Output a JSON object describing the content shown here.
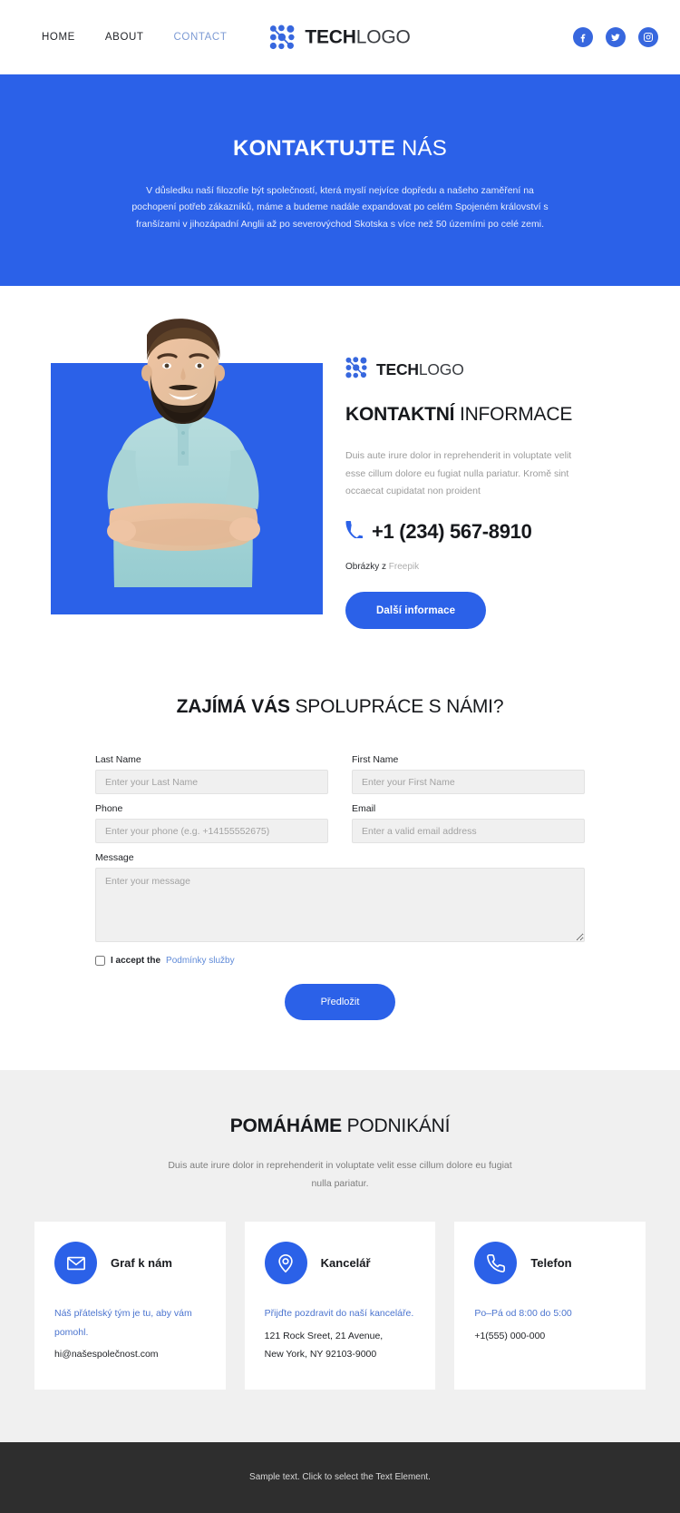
{
  "header": {
    "nav": [
      {
        "label": "HOME",
        "active": false
      },
      {
        "label": "ABOUT",
        "active": false
      },
      {
        "label": "CONTACT",
        "active": true
      }
    ],
    "brand": {
      "bold": "TECH",
      "light": "LOGO"
    },
    "socials": [
      {
        "name": "facebook",
        "label": "Facebook"
      },
      {
        "name": "twitter",
        "label": "Twitter"
      },
      {
        "name": "instagram",
        "label": "Instagram"
      }
    ]
  },
  "hero": {
    "title_bold": "KONTAKTUJTE",
    "title_light": "NÁS",
    "paragraph": "V důsledku naší filozofie být společností, která myslí nejvíce dopředu a našeho zaměření na pochopení potřeb zákazníků, máme a budeme nadále expandovat po celém Spojeném království s franšízami v jihozápadní Anglii až po severovýchod Skotska s více než 50 územími po celé zemi.",
    "background_color": "#2b61e8"
  },
  "contact_info": {
    "brand": {
      "bold": "TECH",
      "light": "LOGO"
    },
    "title_bold": "KONTAKTNÍ",
    "title_light": "INFORMACE",
    "paragraph": "Duis aute irure dolor in reprehenderit in voluptate velit esse cillum dolore eu fugiat nulla pariatur. Kromě sint occaecat cupidatat non proident",
    "phone": "+1 (234) 567-8910",
    "credit_prefix": "Obrázky z",
    "credit_source": "Freepik",
    "button_label": "Další informace",
    "photo_alt": "Smiling bearded man with crossed arms in teal polo shirt"
  },
  "form": {
    "title_bold": "ZAJÍMÁ VÁS",
    "title_light": "SPOLUPRÁCE S NÁMI?",
    "fields": [
      {
        "label": "Last Name",
        "placeholder": "Enter your Last Name",
        "value": "",
        "name": "last-name"
      },
      {
        "label": "First Name",
        "placeholder": "Enter your First Name",
        "value": "",
        "name": "first-name"
      },
      {
        "label": "Phone",
        "placeholder": "Enter your phone (e.g. +14155552675)",
        "value": "",
        "name": "phone"
      },
      {
        "label": "Email",
        "placeholder": "Enter a valid email address",
        "value": "",
        "name": "email"
      }
    ],
    "message": {
      "label": "Message",
      "placeholder": "Enter your message",
      "value": ""
    },
    "accept_text": "I accept the",
    "accept_link": "Podmínky služby",
    "accept_checked": false,
    "submit_label": "Předložit"
  },
  "help": {
    "title_bold": "POMÁHÁME",
    "title_light": "PODNIKÁNÍ",
    "subtitle": "Duis aute irure dolor in reprehenderit in voluptate velit esse cillum dolore eu fugiat nulla pariatur.",
    "cards": [
      {
        "icon": "envelope-icon",
        "title": "Graf k nám",
        "lead": "Náš přátelský tým je tu, aby vám pomohl.",
        "detail": "hi@našespolečnost.com",
        "detail2": ""
      },
      {
        "icon": "map-pin-icon",
        "title": "Kancelář",
        "lead": "Přijďte pozdravit do naší kanceláře.",
        "detail": "121 Rock Sreet, 21 Avenue,",
        "detail2": "New York, NY 92103-9000"
      },
      {
        "icon": "phone-icon",
        "title": "Telefon",
        "lead": "Po–Pá od 8:00 do 5:00",
        "detail": "+1(555) 000-000",
        "detail2": ""
      }
    ]
  },
  "footer": {
    "text": "Sample text. Click to select the Text Element."
  },
  "colors": {
    "accent": "#2b61e8",
    "footer_bg": "#2e2e2e",
    "section_bg": "#f0f0f0"
  }
}
